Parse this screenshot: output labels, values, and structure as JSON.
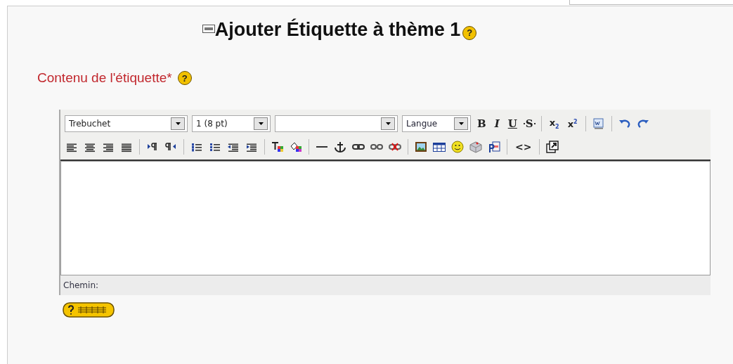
{
  "heading": {
    "title": "Ajouter Étiquette à thème 1",
    "help": "?"
  },
  "field": {
    "label": "Contenu de l'étiquette",
    "required_mark": "*",
    "help": "?"
  },
  "editor": {
    "toolbar_rows": [
      [
        {
          "kind": "select",
          "value": "Trebuchet"
        },
        {
          "kind": "select",
          "value": "1 (8 pt)"
        },
        {
          "kind": "select"
        },
        {
          "kind": "select",
          "value": "Langue"
        },
        {
          "kind": "letter",
          "label": "B"
        },
        {
          "kind": "letter",
          "label": "I"
        },
        {
          "kind": "letter",
          "label": "U"
        },
        {
          "kind": "letter",
          "label": "S"
        },
        {
          "kind": "separator"
        },
        {
          "kind": "letter",
          "label": "x$_{2}$"
        },
        {
          "kind": "letter",
          "label": "x$^{2}$"
        },
        {
          "kind": "separator"
        },
        {
          "kind": "icon"
        },
        {
          "kind": "separator"
        },
        {
          "kind": "icon"
        },
        {
          "kind": "icon"
        }
      ],
      [
        {
          "kind": "icon"
        },
        {
          "kind": "icon"
        },
        {
          "kind": "icon"
        },
        {
          "kind": "icon"
        },
        {
          "kind": "separator"
        },
        {
          "kind": "icon"
        },
        {
          "kind": "icon"
        },
        {
          "kind": "separator"
        },
        {
          "kind": "icon"
        },
        {
          "kind": "icon"
        },
        {
          "kind": "icon"
        },
        {
          "kind": "icon"
        },
        {
          "kind": "separator"
        },
        {
          "kind": "icon"
        },
        {
          "kind": "icon"
        },
        {
          "kind": "separator"
        },
        {
          "kind": "icon"
        },
        {
          "kind": "icon"
        },
        {
          "kind": "icon"
        },
        {
          "kind": "icon"
        },
        {
          "kind": "icon"
        },
        {
          "kind": "separator"
        },
        {
          "kind": "icon"
        },
        {
          "kind": "icon"
        },
        {
          "kind": "icon"
        },
        {
          "kind": "icon"
        },
        {
          "kind": "icon"
        },
        {
          "kind": "separator"
        },
        {
          "kind": "letter",
          "label": "<>"
        },
        {
          "kind": "separator"
        },
        {
          "kind": "icon"
        }
      ]
    ],
    "path_label": "Chemin:"
  }
}
